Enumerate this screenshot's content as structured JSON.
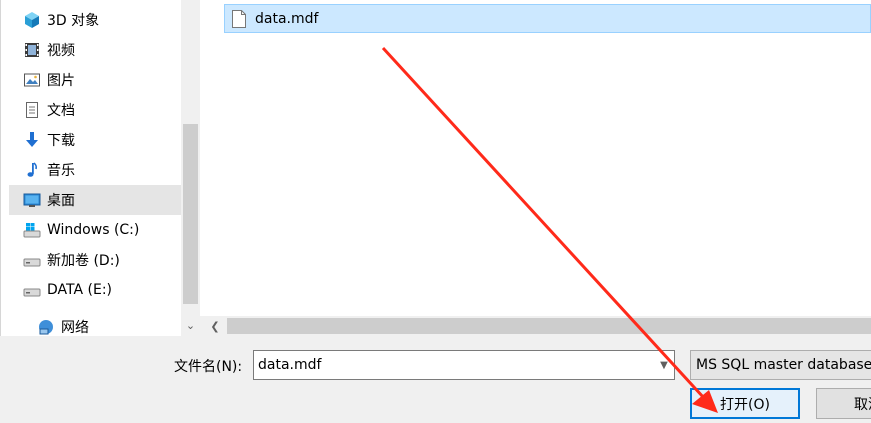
{
  "nav": {
    "items": [
      {
        "label": "3D 对象",
        "icon": "3d-objects-icon"
      },
      {
        "label": "视频",
        "icon": "video-icon"
      },
      {
        "label": "图片",
        "icon": "pictures-icon"
      },
      {
        "label": "文档",
        "icon": "documents-icon"
      },
      {
        "label": "下载",
        "icon": "downloads-icon"
      },
      {
        "label": "音乐",
        "icon": "music-icon"
      },
      {
        "label": "桌面",
        "icon": "desktop-icon",
        "selected": true
      },
      {
        "label": "Windows (C:)",
        "icon": "windows-drive-icon"
      },
      {
        "label": "新加卷 (D:)",
        "icon": "drive-icon"
      },
      {
        "label": "DATA (E:)",
        "icon": "drive-icon"
      },
      {
        "label": "网络",
        "icon": "network-icon"
      }
    ]
  },
  "files": [
    {
      "name": "data.mdf",
      "selected": true
    }
  ],
  "bottom": {
    "filename_label": "文件名(N):",
    "filename_value": "data.mdf",
    "filetype_value": "MS SQL master database",
    "open_label": "打开(O)",
    "cancel_label": "取消"
  },
  "colors": {
    "selection": "#cce8ff",
    "accent": "#0078d7",
    "annotation_arrow": "#ff2a1a"
  }
}
